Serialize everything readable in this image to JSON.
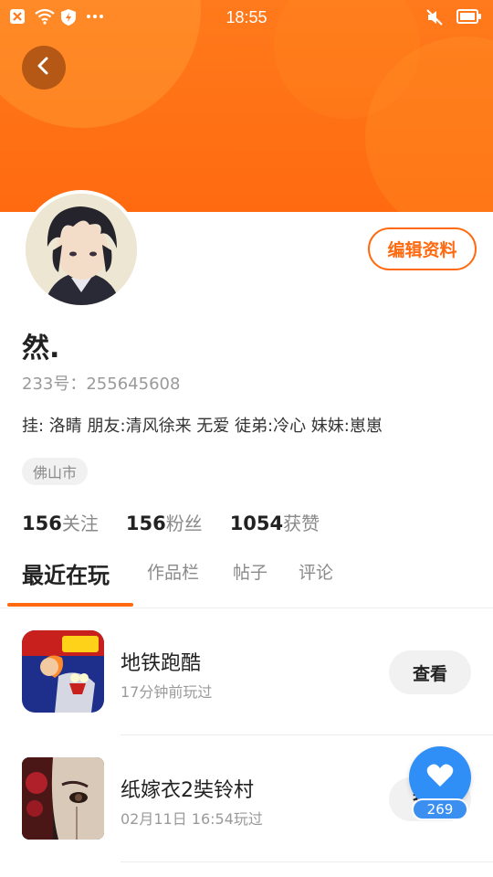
{
  "status_bar": {
    "time": "18:55"
  },
  "profile": {
    "edit_label": "编辑资料",
    "username": "然.",
    "uid": "233号：255645608",
    "bio": "挂: 洛睛 朋友:清风徐来 无爱 徒弟:冷心 妹妹:崽崽",
    "location": "佛山市"
  },
  "stats": [
    {
      "value": "156",
      "label": "关注"
    },
    {
      "value": "156",
      "label": "粉丝"
    },
    {
      "value": "1054",
      "label": "获赞"
    }
  ],
  "tabs": [
    "最近在玩",
    "作品栏",
    "帖子",
    "评论"
  ],
  "games": [
    {
      "name": "地铁跑酷",
      "time": "17分钟前玩过",
      "action": "查看",
      "icon": "subway-surfers-icon"
    },
    {
      "name": "纸嫁衣2奘铃村",
      "time": "02月11日 16:54玩过",
      "action": "查看",
      "icon": "paper-bride-icon"
    }
  ],
  "like_fab": {
    "count": "269",
    "icon": "heart-icon"
  },
  "colors": {
    "accent": "#ff6a10",
    "fab": "#2f8ff7"
  }
}
